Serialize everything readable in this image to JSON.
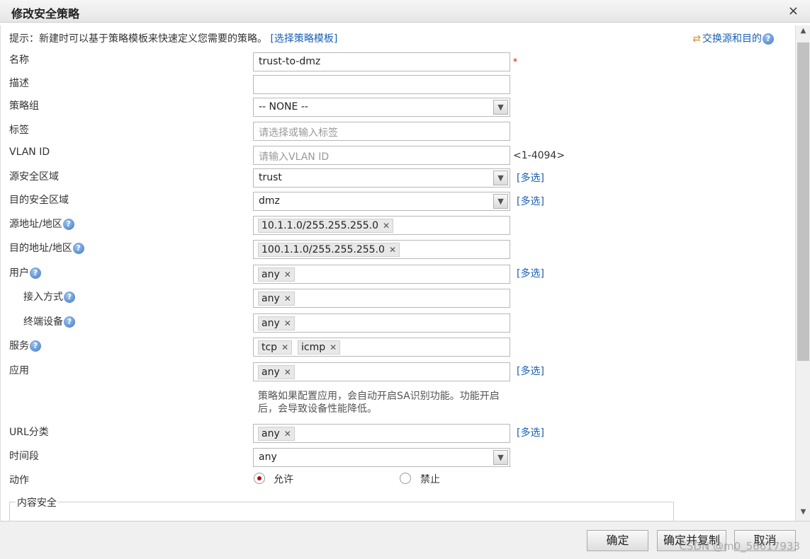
{
  "window": {
    "title": "修改安全策略",
    "close_glyph": "×"
  },
  "hint": {
    "prefix": "提示：新建时可以基于策略模板来快速定义您需要的策略。",
    "link": "[选择策略模板]"
  },
  "swap": {
    "label": "交换源和目的",
    "icon": "swap-arrows-icon"
  },
  "help_glyph": "?",
  "rows": {
    "name": {
      "label": "名称",
      "value": "trust-to-dmz",
      "required": "*"
    },
    "desc": {
      "label": "描述",
      "value": ""
    },
    "group": {
      "label": "策略组",
      "value": "-- NONE --"
    },
    "tag": {
      "label": "标签",
      "placeholder": "请选择或输入标签"
    },
    "vlan": {
      "label": "VLAN ID",
      "placeholder": "请输入VLAN ID",
      "range": "<1-4094>"
    },
    "src_zone": {
      "label": "源安全区域",
      "value": "trust",
      "multi": "[多选]"
    },
    "dst_zone": {
      "label": "目的安全区域",
      "value": "dmz",
      "multi": "[多选]"
    },
    "src_addr": {
      "label": "源地址/地区",
      "tags": [
        "10.1.1.0/255.255.255.0"
      ]
    },
    "dst_addr": {
      "label": "目的地址/地区",
      "tags": [
        "100.1.1.0/255.255.255.0"
      ]
    },
    "user": {
      "label": "用户",
      "tags": [
        "any"
      ],
      "multi": "[多选]"
    },
    "access": {
      "label": "接入方式",
      "tags": [
        "any"
      ]
    },
    "device": {
      "label": "终端设备",
      "tags": [
        "any"
      ]
    },
    "service": {
      "label": "服务",
      "tags": [
        "tcp",
        "icmp"
      ]
    },
    "app": {
      "label": "应用",
      "tags": [
        "any"
      ],
      "multi": "[多选]",
      "note_line1": "策略如果配置应用，会自动开启SA识别功能。功能开启",
      "note_line2": "后，会导致设备性能降低。"
    },
    "url": {
      "label": "URL分类",
      "tags": [
        "any"
      ],
      "multi": "[多选]"
    },
    "time": {
      "label": "时间段",
      "value": "any"
    },
    "action": {
      "label": "动作",
      "allow": "允许",
      "deny": "禁止",
      "selected": "允许"
    }
  },
  "content_security": {
    "legend": "内容安全"
  },
  "footer": {
    "ok": "确定",
    "ok_copy": "确定并复制",
    "cancel": "取消",
    "watermark": "CSDN @m0_56617933"
  },
  "colors": {
    "link": "#1a5fb4",
    "required": "#dd0000",
    "radio_selected": "#b01010"
  }
}
